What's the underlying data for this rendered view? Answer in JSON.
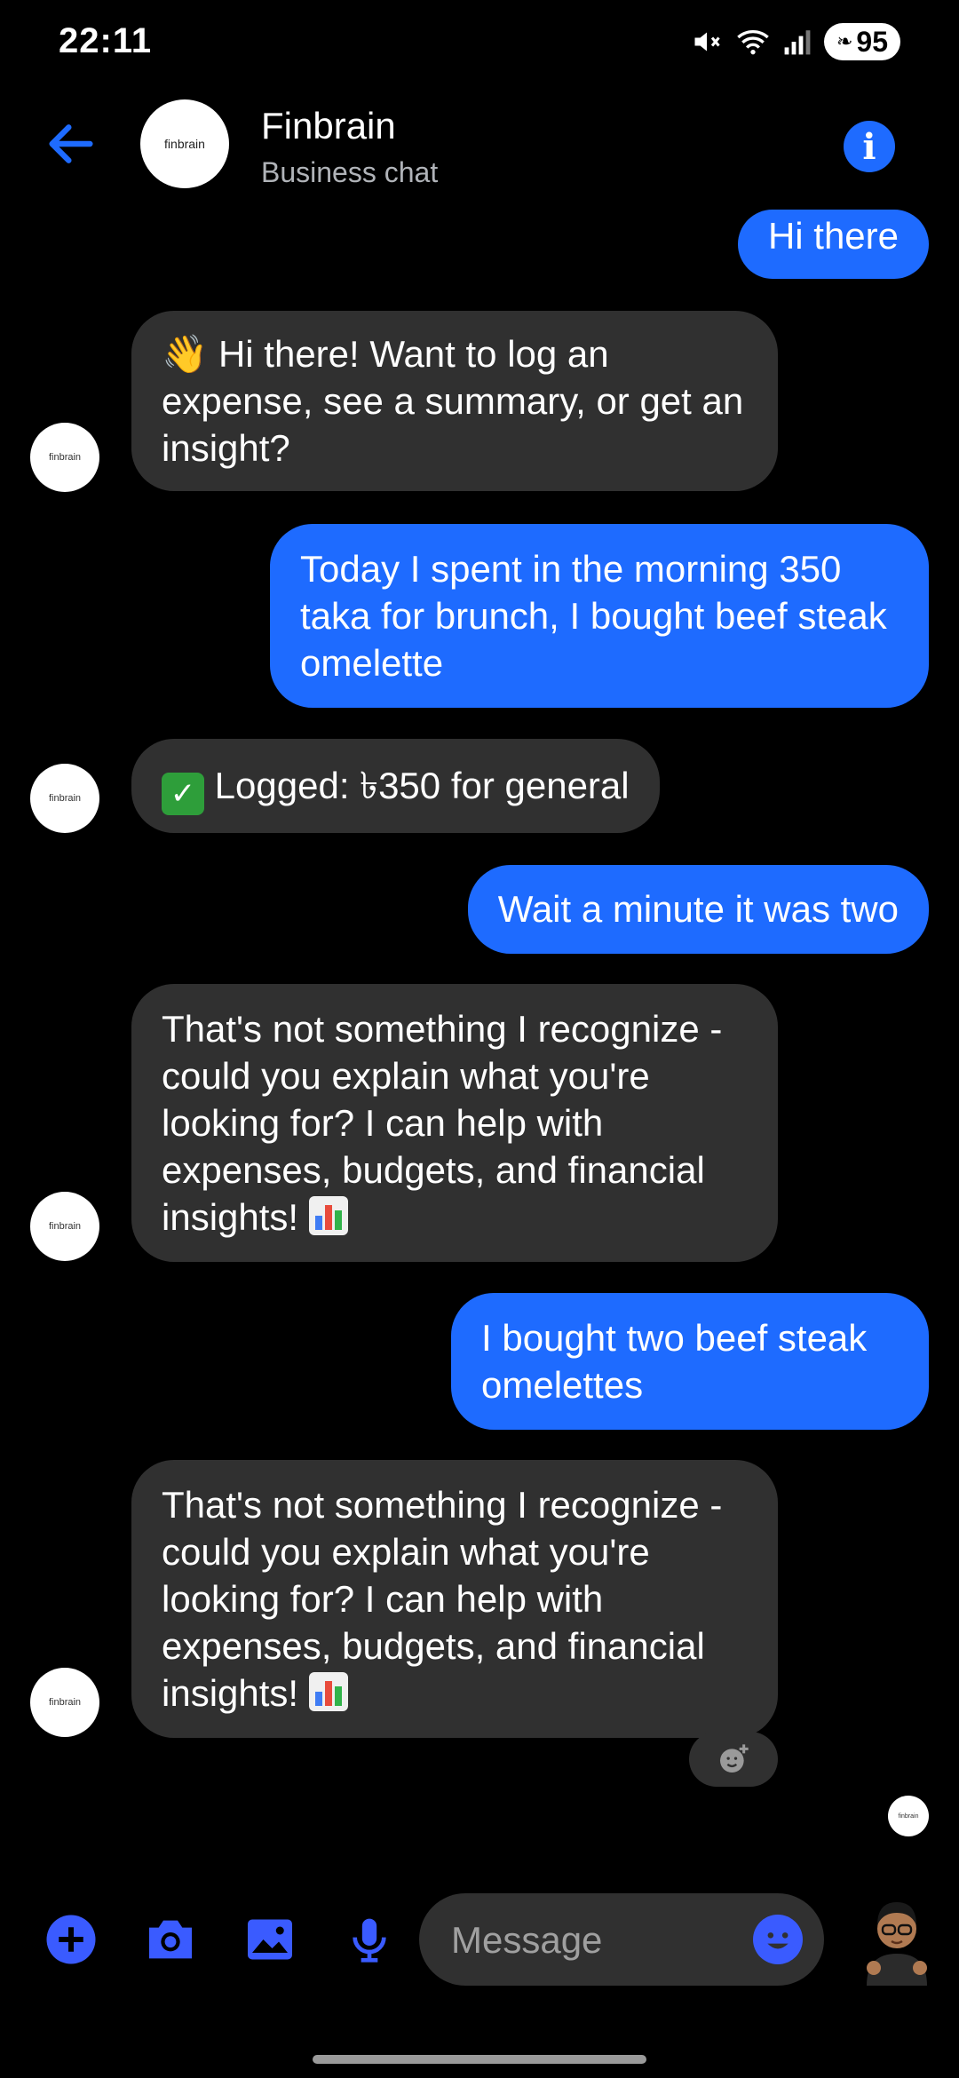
{
  "status": {
    "time": "22:11",
    "battery": "95"
  },
  "header": {
    "title": "Finbrain",
    "subtitle": "Business chat",
    "avatar_text": "finbrain"
  },
  "messages": [
    {
      "from": "user",
      "text": "Hi there"
    },
    {
      "from": "bot",
      "emoji": "👋",
      "text": " Hi there! Want to log an expense, see a summary, or get an insight?"
    },
    {
      "from": "user",
      "text": "Today I spent in the morning 350 taka for brunch, I bought beef steak omelette"
    },
    {
      "from": "bot",
      "emoji": "✅",
      "text": " Logged: ৳350 for general"
    },
    {
      "from": "user",
      "text": "Wait a minute it was two"
    },
    {
      "from": "bot",
      "text": "That's not something I recognize - could you explain what you're looking for? I can help with expenses, budgets, and financial insights! "
    },
    {
      "from": "user",
      "text": "I bought two beef steak omelettes"
    },
    {
      "from": "bot",
      "text": "That's not something I recognize - could you explain what you're looking for? I can help with expenses, budgets, and financial insights! "
    }
  ],
  "bot_avatar_text": "finbrain",
  "composer": {
    "placeholder": "Message"
  },
  "colors": {
    "accent": "#1e6bff",
    "bubble_received": "#303030",
    "background": "#000000"
  },
  "icons": [
    "arrow-left-icon",
    "info-icon",
    "plus-icon",
    "camera-icon",
    "image-icon",
    "mic-icon",
    "emoji-icon",
    "add-reaction-icon"
  ]
}
